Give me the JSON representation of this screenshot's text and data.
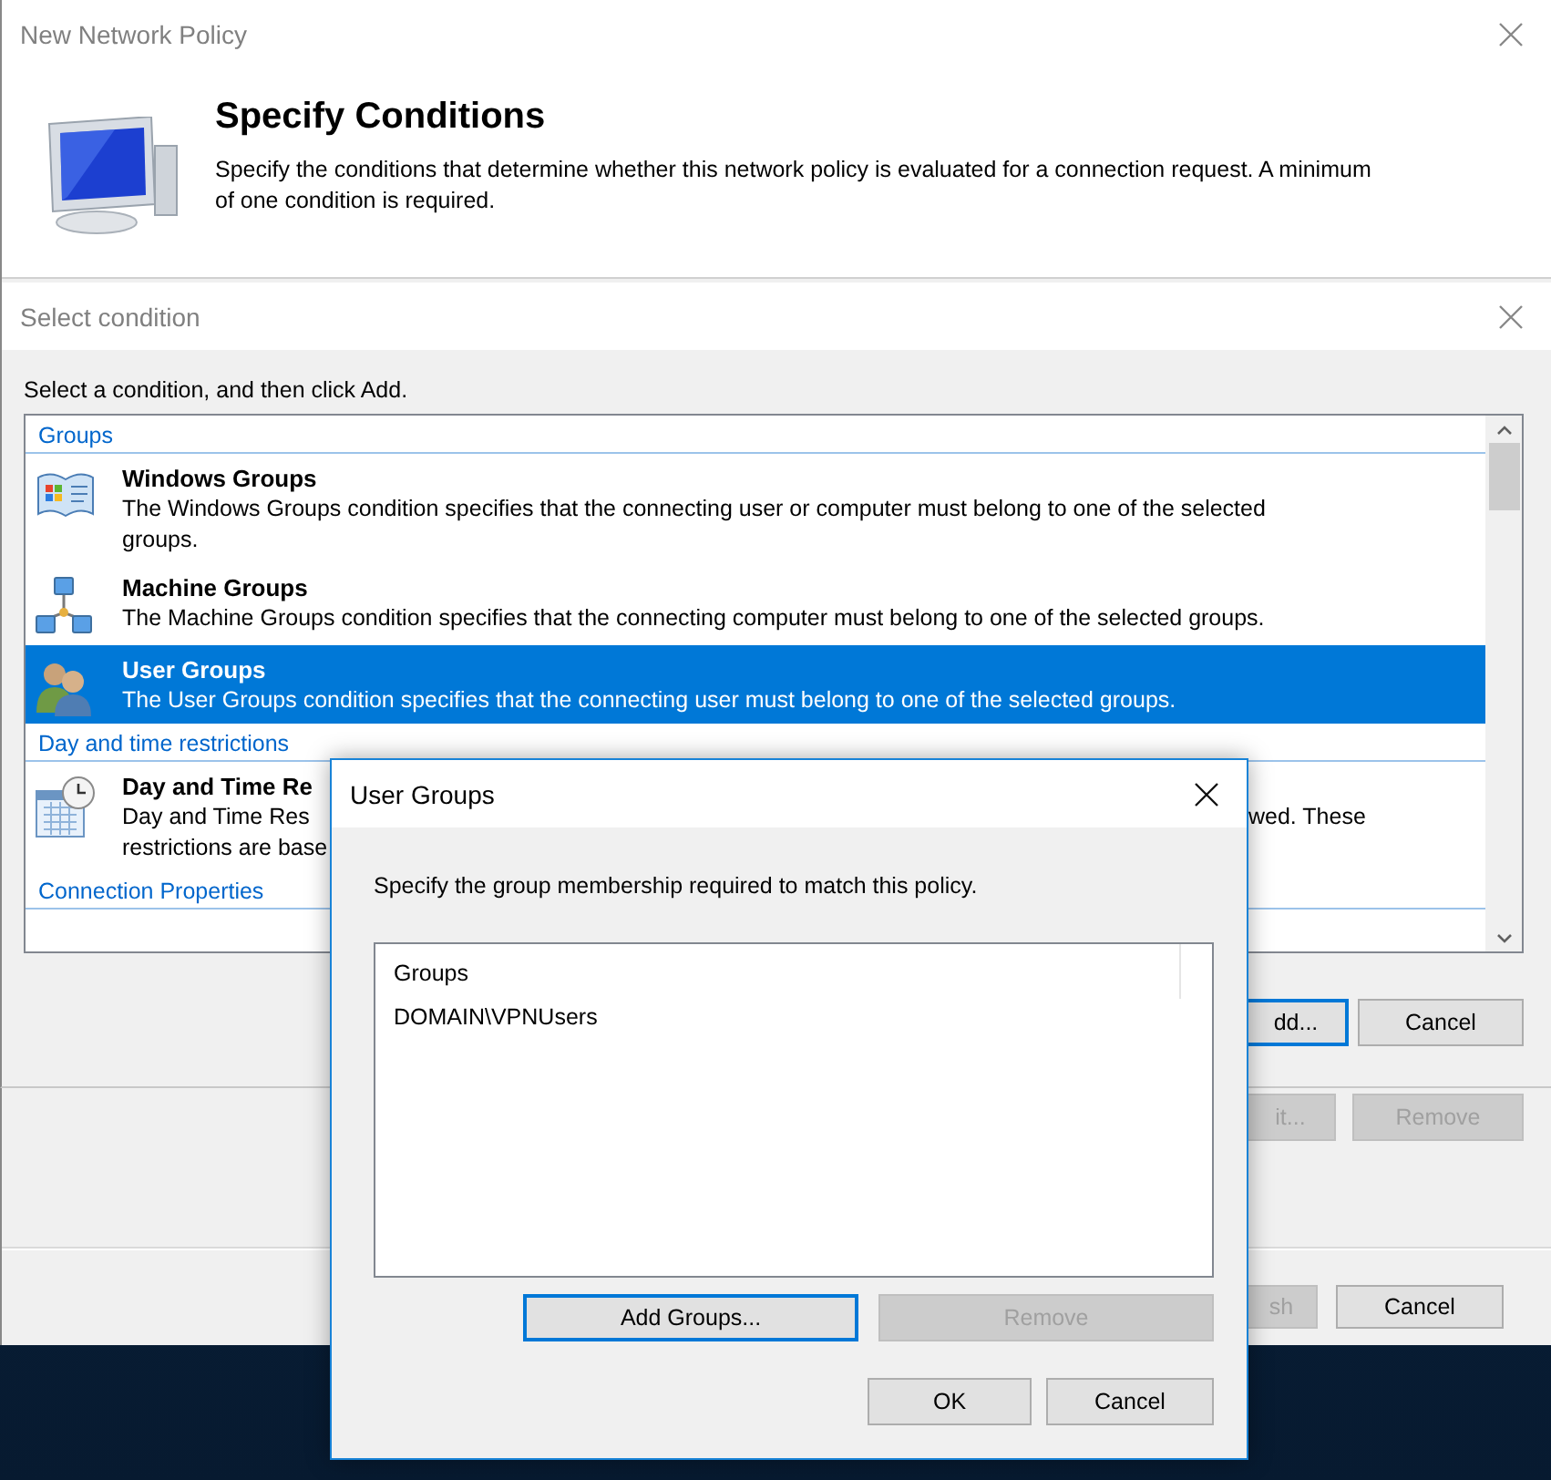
{
  "main_window": {
    "title": "New Network Policy",
    "active": false,
    "heading": "Specify Conditions",
    "description": [
      "Specify the conditions that determine whether this network policy is evaluated for a connection request. A minimum",
      "of one condition is required."
    ],
    "buttons": [
      {
        "label": "sh",
        "disabled": true,
        "focused": false
      },
      {
        "label": "Cancel",
        "disabled": false,
        "focused": false
      }
    ]
  },
  "select_condition": {
    "title": "Select condition",
    "active": false,
    "instruction": "Select a condition, and then click Add.",
    "sections": [
      {
        "label": "Groups",
        "items": [
          {
            "kind": "full",
            "title": "Windows Groups",
            "description": [
              {
                "text": "The Windows Groups condition specifies that the connecting user or computer must belong to one of the selected"
              },
              {
                "text": "groups."
              }
            ],
            "selected": false
          },
          {
            "kind": "full",
            "title": "Machine Groups",
            "description": [
              {
                "text": "The Machine Groups condition specifies that the connecting computer must belong to one of the selected groups."
              }
            ],
            "selected": false
          },
          {
            "kind": "full",
            "title": "User Groups",
            "description": [
              {
                "text": "The User Groups condition specifies that the connecting user must belong to one of the selected groups."
              }
            ],
            "selected": true
          }
        ]
      },
      {
        "label": "Day and time restrictions",
        "items": [
          {
            "kind": "clipped",
            "title": "Day and Time Re",
            "description": [
              {
                "text": "Day and Time Res",
                "tail": "wed.  These"
              },
              {
                "text": "restrictions are base"
              }
            ],
            "selected": false
          }
        ]
      },
      {
        "label": "Connection Properties"
      }
    ],
    "buttons": [
      [
        {
          "label": "dd...",
          "disabled": false,
          "focused": true
        },
        {
          "label": "Cancel",
          "disabled": false,
          "focused": false
        }
      ],
      [
        {
          "label": "it...",
          "disabled": true,
          "focused": false
        },
        {
          "label": "Remove",
          "disabled": true,
          "focused": false
        }
      ]
    ]
  },
  "user_groups_dialog": {
    "title": "User Groups",
    "active": true,
    "instruction": "Specify the group membership required to match this policy.",
    "list": {
      "column": "Groups",
      "rows": [
        {
          "text": "DOMAIN\\VPNUsers",
          "selected": false
        }
      ]
    },
    "buttons": [
      [
        {
          "label": "Add Groups...",
          "disabled": false,
          "focused": true
        },
        {
          "label": "Remove",
          "disabled": true,
          "focused": false
        }
      ],
      [
        {
          "label": "OK",
          "disabled": false,
          "focused": false
        },
        {
          "label": "Cancel",
          "disabled": false,
          "focused": false
        }
      ]
    ]
  }
}
